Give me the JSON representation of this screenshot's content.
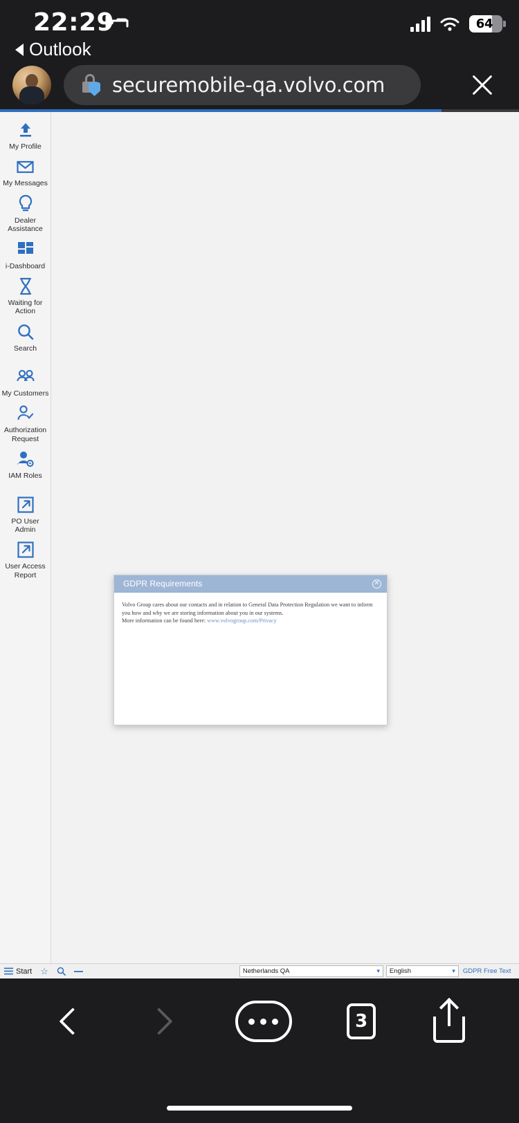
{
  "status_bar": {
    "time": "22:29",
    "sleep_icon": "bed-icon",
    "signal_icon": "cellular-signal-icon",
    "wifi_icon": "wifi-icon",
    "battery_percent": "64"
  },
  "back_to_app": {
    "label": "Outlook",
    "icon": "back-triangle-icon"
  },
  "browser": {
    "url": "securemobile-qa.volvo.com",
    "lock_icon": "lock-shield-icon",
    "close_icon": "close-icon",
    "avatar": "user-avatar"
  },
  "sidebar": {
    "items": [
      {
        "label": "My Profile",
        "icon": "upload-arrow-icon"
      },
      {
        "label": "My Messages",
        "icon": "envelope-icon"
      },
      {
        "label": "Dealer Assistance",
        "icon": "lightbulb-icon"
      },
      {
        "label": "i-Dashboard",
        "icon": "dashboard-grid-icon"
      },
      {
        "label": "Waiting for Action",
        "icon": "hourglass-icon"
      },
      {
        "label": "Search",
        "icon": "magnifier-icon"
      },
      {
        "label": "My Customers",
        "icon": "people-icon"
      },
      {
        "label": "Authorization Request",
        "icon": "person-check-icon"
      },
      {
        "label": "IAM Roles",
        "icon": "person-gear-icon"
      },
      {
        "label": "PO User Admin",
        "icon": "external-link-icon"
      },
      {
        "label": "User Access Report",
        "icon": "external-link-icon"
      }
    ]
  },
  "dialog": {
    "title": "GDPR Requirements",
    "close_icon": "close-circle-icon",
    "paragraph_1": "Volvo Group cares about our contacts and in relation to General Data Protection Regulation we want to inform you how and why we are storing information about you in our systems.",
    "paragraph_2_prefix": "More information can be found here: ",
    "link_text": "www.volvogroup.com/Privacy"
  },
  "web_footer": {
    "start_label": "Start",
    "menu_icon": "hamburger-icon",
    "favorite_icon": "star-icon",
    "search_icon": "magnifier-icon",
    "minimize_icon": "minus-icon",
    "country_select": "Netherlands QA",
    "language_select": "English",
    "gdpr_link": "GDPR Free Text",
    "chevron_icon": "chevron-down-icon"
  },
  "toolbar": {
    "back_icon": "chevron-left-icon",
    "forward_icon": "chevron-right-icon",
    "more_icon": "more-dots-icon",
    "tab_count": "3",
    "share_icon": "share-icon"
  },
  "colors": {
    "accent_blue": "#2f6fc0",
    "dialog_header": "#9eb6d6",
    "progress": "#2f6fc0"
  }
}
